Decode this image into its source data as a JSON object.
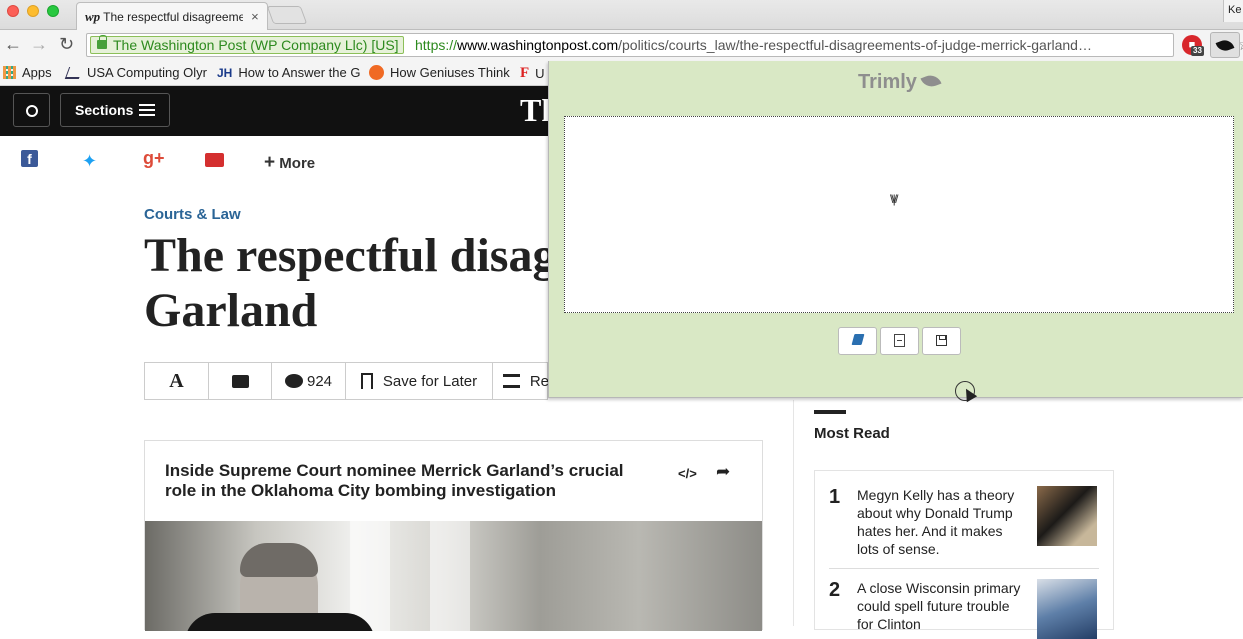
{
  "browser": {
    "tab_title": "The respectful disagreeme",
    "tab_favicon": "wp",
    "tab_close": "×",
    "corner_text": "Ke",
    "security_label": "The Washington Post (WP Company Llc) [US]",
    "url_scheme": "https://",
    "url_host": "www.washingtonpost.com",
    "url_path": "/politics/courts_law/the-respectful-disagreements-of-judge-merrick-garland…",
    "extension_badge": "33",
    "bookmarks": [
      {
        "label": "Apps",
        "icon": "apps-grid-icon"
      },
      {
        "label": "USA Computing Olyr",
        "icon": "usaco-icon"
      },
      {
        "label": "How to Answer the G",
        "icon": "jh-icon"
      },
      {
        "label": "How Geniuses Think",
        "icon": "orange-circle-icon"
      },
      {
        "label": "U",
        "icon": "f-icon"
      }
    ]
  },
  "wapo": {
    "sections_label": "Sections",
    "logo_fragment": "Th",
    "share_more": "More",
    "kicker": "Courts & Law",
    "headline_line1": "The respectful disag",
    "headline_line2": "Garland",
    "util": {
      "font_glyph": "A",
      "comments_count": "924",
      "save_label": "Save for Later",
      "reading_list_fragment": "Re"
    },
    "video": {
      "title": "Inside Supreme Court nominee Merrick Garland’s crucial role in the Oklahoma City bombing investigation",
      "embed_glyph": "</>"
    },
    "most_read": {
      "title": "Most Read",
      "items": [
        {
          "num": "1",
          "text": "Megyn Kelly has a theory about why Donald Trump hates her. And it makes lots of sense."
        },
        {
          "num": "2",
          "text": "A close Wisconsin primary could spell future trouble for Clinton"
        }
      ]
    }
  },
  "trimly": {
    "title": "Trimly",
    "spinner": "\\\\|//",
    "buttons": [
      {
        "name": "read-button",
        "icon": "book-icon"
      },
      {
        "name": "pdf-button",
        "icon": "pdf-icon"
      },
      {
        "name": "save-button",
        "icon": "disk-icon"
      }
    ]
  },
  "colors": {
    "trimly_bg": "#d9e8c5",
    "wapo_link": "#2a6496",
    "secure_green": "#2d8a1e"
  }
}
